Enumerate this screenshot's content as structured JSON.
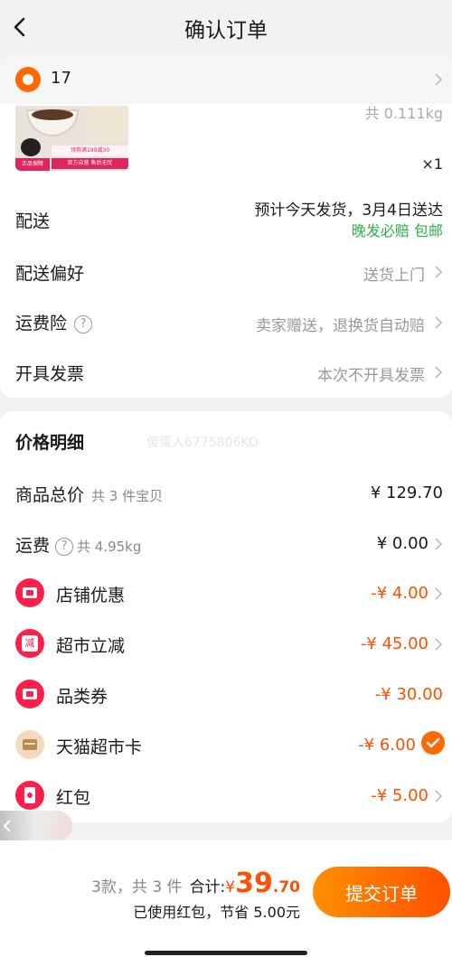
{
  "header": {
    "title": "确认订单"
  },
  "store": {
    "name": "17"
  },
  "product": {
    "weight": "共 0.111kg",
    "quantity": "×1",
    "image_promo": "领券满199减30",
    "image_badges": "官方自营 售后无忧",
    "image_tag": "正品保障"
  },
  "order_info": {
    "delivery": {
      "label": "配送",
      "estimate": "预计今天发货，3月4日送达",
      "guarantee": "晚发必赔 包邮"
    },
    "preference": {
      "label": "配送偏好",
      "value": "送货上门"
    },
    "insurance": {
      "label": "运费险",
      "value": "卖家赠送，退换货自动赔"
    },
    "invoice": {
      "label": "开具发票",
      "value": "本次不开具发票"
    }
  },
  "price_detail": {
    "title": "价格明细",
    "watermark": "傻蛋人6775806KO",
    "subtotal": {
      "label": "商品总价",
      "sub": "共 3 件宝贝",
      "value": "¥ 129.70"
    },
    "shipping": {
      "label": "运费",
      "sub": "共 4.95kg",
      "value": "¥ 0.00"
    },
    "discounts": [
      {
        "label": "店铺优惠",
        "value": "-¥ 4.00"
      },
      {
        "label": "超市立减",
        "value": "-¥ 45.00"
      },
      {
        "label": "品类券",
        "value": "-¥ 30.00"
      },
      {
        "label": "天猫超市卡",
        "value": "-¥ 6.00"
      },
      {
        "label": "红包",
        "value": "-¥ 5.00"
      }
    ]
  },
  "footer": {
    "count": "3款，共 3 件",
    "total_label": "合计:",
    "currency": "¥",
    "amount_int": "39",
    "amount_dec": ".70",
    "savings": "已使用红包，节省 5.00元",
    "submit": "提交订单"
  },
  "colors": {
    "accent": "#ff5000",
    "green": "#2bb04a",
    "badge_red": "#ff1f4a"
  }
}
